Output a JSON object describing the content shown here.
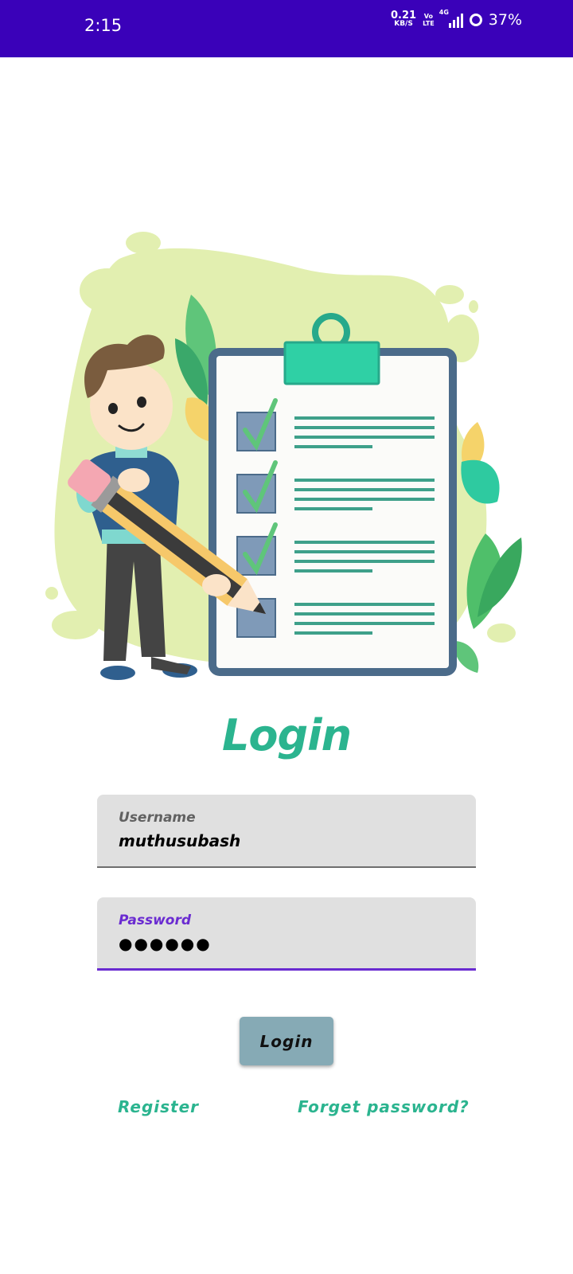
{
  "status_bar": {
    "time": "2:15",
    "net_speed_value": "0.21",
    "net_speed_unit": "KB/S",
    "volte_top": "Vo",
    "volte_bottom": "LTE",
    "network_type": "4G",
    "battery_percent": "37%"
  },
  "illustration": {
    "icon": "person-with-pencil-and-checklist-illustration",
    "checklist_items_checked": 3,
    "checklist_items_total": 4
  },
  "login": {
    "title": "Login",
    "username": {
      "label": "Username",
      "value": "muthusubash"
    },
    "password": {
      "label": "Password",
      "value": "●●●●●●"
    },
    "button_label": "Login",
    "register_label": "Register",
    "forget_label": "Forget password?"
  },
  "colors": {
    "status_bar": "#3a01b9",
    "accent_green": "#2bb48f",
    "focus_purple": "#6a2bd1",
    "field_bg": "#e0e0e0",
    "button_bg": "#86aab5"
  }
}
